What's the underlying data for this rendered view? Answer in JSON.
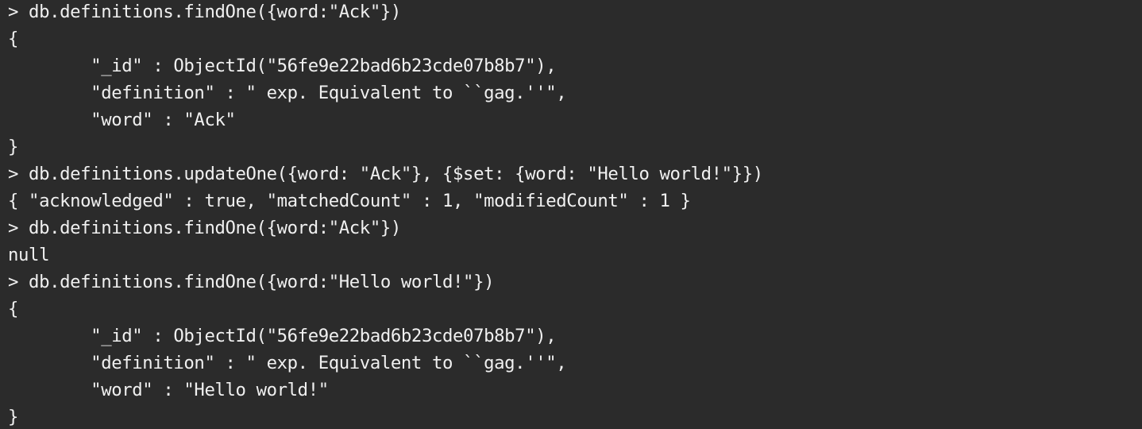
{
  "terminal": {
    "background": "#2b2b2b",
    "foreground": "#f0f0f0",
    "lines": [
      "> db.definitions.findOne({word:\"Ack\"})",
      "{",
      "        \"_id\" : ObjectId(\"56fe9e22bad6b23cde07b8b7\"),",
      "        \"definition\" : \" exp. Equivalent to ``gag.''\",",
      "        \"word\" : \"Ack\"",
      "}",
      "> db.definitions.updateOne({word: \"Ack\"}, {$set: {word: \"Hello world!\"}})",
      "{ \"acknowledged\" : true, \"matchedCount\" : 1, \"modifiedCount\" : 1 }",
      "> db.definitions.findOne({word:\"Ack\"})",
      "null",
      "> db.definitions.findOne({word:\"Hello world!\"})",
      "{",
      "        \"_id\" : ObjectId(\"56fe9e22bad6b23cde07b8b7\"),",
      "        \"definition\" : \" exp. Equivalent to ``gag.''\",",
      "        \"word\" : \"Hello world!\"",
      "}"
    ]
  }
}
